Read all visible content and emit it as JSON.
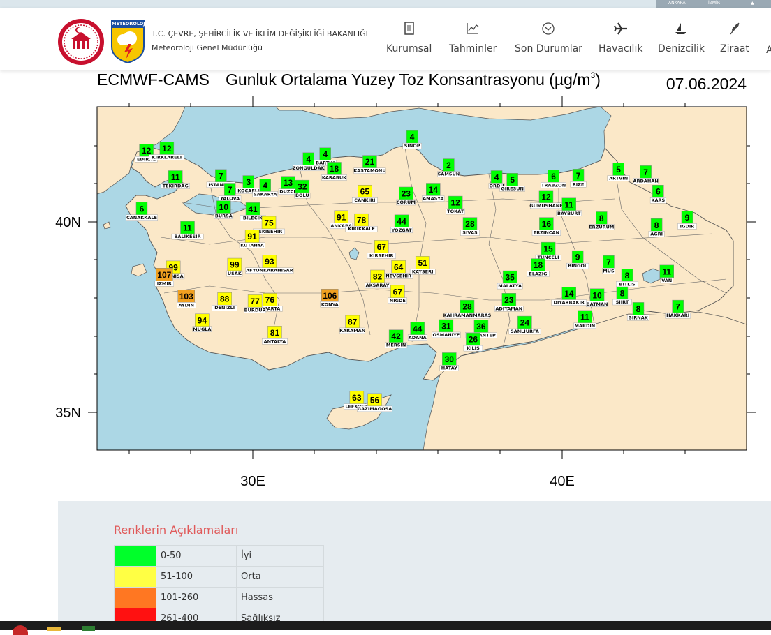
{
  "top_strip": {
    "buttons": [
      "ANKARA",
      "İZMİR"
    ]
  },
  "header": {
    "org_line1": "T.C. ÇEVRE, ŞEHİRCİLİK VE İKLİM DEĞİŞİKLİĞİ BAKANLIĞI",
    "org_line2": "Meteoroloji Genel Müdürlüğü",
    "logo_text": "METEOROLOJİ",
    "nav": [
      {
        "label": "Kurumsal",
        "icon": "document-icon"
      },
      {
        "label": "Tahminler",
        "icon": "chart-icon"
      },
      {
        "label": "Son Durumlar",
        "icon": "chevron-circle-icon"
      },
      {
        "label": "Havacılık",
        "icon": "airplane-icon"
      },
      {
        "label": "Denizcilik",
        "icon": "boat-icon"
      },
      {
        "label": "Ziraat",
        "icon": "wheat-icon"
      },
      {
        "label": "A",
        "icon": ""
      }
    ]
  },
  "map": {
    "title_left": "ECMWF-CAMS",
    "title_main": "Gunluk Ortalama Yuzey Toz Konsantrasyonu (µg/m",
    "title_sup": "3",
    "title_close": ")",
    "date": "07.06.2024",
    "lat_labels": [
      "40N",
      "35N"
    ],
    "lon_labels": [
      "30E",
      "40E"
    ],
    "colors": {
      "sea": "#acd7e5",
      "land": "#fbe8c8",
      "good": "#00ff00",
      "moderate": "#ffff00",
      "sensitive": "#f0a020",
      "border": "#555555"
    },
    "stations": [
      {
        "name": "EDIRNE",
        "value": "12",
        "lon": 26.56,
        "lat": 41.68
      },
      {
        "name": "KIRKLARELI",
        "value": "12",
        "lon": 27.22,
        "lat": 41.73
      },
      {
        "name": "TEKIRDAG",
        "value": "11",
        "lon": 27.5,
        "lat": 40.98
      },
      {
        "name": "ISTANBUL",
        "value": "7",
        "lon": 28.97,
        "lat": 41.01
      },
      {
        "name": "YALOVA",
        "value": "7",
        "lon": 29.26,
        "lat": 40.65
      },
      {
        "name": "KOCAELI",
        "value": "3",
        "lon": 29.86,
        "lat": 40.85
      },
      {
        "name": "SAKARYA",
        "value": "4",
        "lon": 30.4,
        "lat": 40.76
      },
      {
        "name": "DUZCE",
        "value": "13",
        "lon": 31.14,
        "lat": 40.83
      },
      {
        "name": "BOLU",
        "value": "32",
        "lon": 31.6,
        "lat": 40.73
      },
      {
        "name": "ZONGULDAK",
        "value": "4",
        "lon": 31.8,
        "lat": 41.45
      },
      {
        "name": "BARTIN",
        "value": "4",
        "lon": 32.34,
        "lat": 41.58
      },
      {
        "name": "KARABUK",
        "value": "18",
        "lon": 32.63,
        "lat": 41.2
      },
      {
        "name": "KASTAMONU",
        "value": "21",
        "lon": 33.78,
        "lat": 41.38
      },
      {
        "name": "SINOP",
        "value": "4",
        "lon": 35.15,
        "lat": 42.03
      },
      {
        "name": "SAMSUN",
        "value": "2",
        "lon": 36.33,
        "lat": 41.29
      },
      {
        "name": "CANAKKALE",
        "value": "6",
        "lon": 26.41,
        "lat": 40.15
      },
      {
        "name": "BURSA",
        "value": "10",
        "lon": 29.06,
        "lat": 40.19
      },
      {
        "name": "BILECIK",
        "value": "41",
        "lon": 30.0,
        "lat": 40.14
      },
      {
        "name": "ESKISEHIR",
        "value": "75",
        "lon": 30.52,
        "lat": 39.78
      },
      {
        "name": "BALIKESIR",
        "value": "11",
        "lon": 27.89,
        "lat": 39.65
      },
      {
        "name": "KUTAHYA",
        "value": "91",
        "lon": 29.98,
        "lat": 39.42
      },
      {
        "name": "ANKARA",
        "value": "91",
        "lon": 32.86,
        "lat": 39.93
      },
      {
        "name": "KIRIKKALE",
        "value": "78",
        "lon": 33.51,
        "lat": 39.85
      },
      {
        "name": "CANKIRI",
        "value": "65",
        "lon": 33.62,
        "lat": 40.6
      },
      {
        "name": "CORUM",
        "value": "23",
        "lon": 34.95,
        "lat": 40.55
      },
      {
        "name": "AMASYA",
        "value": "14",
        "lon": 35.83,
        "lat": 40.65
      },
      {
        "name": "TOKAT",
        "value": "12",
        "lon": 36.55,
        "lat": 40.31
      },
      {
        "name": "YOZGAT",
        "value": "44",
        "lon": 34.81,
        "lat": 39.82
      },
      {
        "name": "SIVAS",
        "value": "28",
        "lon": 37.02,
        "lat": 39.75
      },
      {
        "name": "ORDU",
        "value": "4",
        "lon": 37.88,
        "lat": 40.98
      },
      {
        "name": "GIRESUN",
        "value": "5",
        "lon": 38.39,
        "lat": 40.91
      },
      {
        "name": "TRABZON",
        "value": "6",
        "lon": 39.72,
        "lat": 41.0
      },
      {
        "name": "RIZE",
        "value": "7",
        "lon": 40.52,
        "lat": 41.02
      },
      {
        "name": "ARTVIN",
        "value": "5",
        "lon": 41.82,
        "lat": 41.18
      },
      {
        "name": "ARDAHAN",
        "value": "7",
        "lon": 42.7,
        "lat": 41.11
      },
      {
        "name": "KARS",
        "value": "6",
        "lon": 43.1,
        "lat": 40.6
      },
      {
        "name": "GUMUSHANE",
        "value": "12",
        "lon": 39.48,
        "lat": 40.46
      },
      {
        "name": "BAYBURT",
        "value": "11",
        "lon": 40.22,
        "lat": 40.26
      },
      {
        "name": "ERZURUM",
        "value": "8",
        "lon": 41.27,
        "lat": 39.9
      },
      {
        "name": "AGRI",
        "value": "8",
        "lon": 43.05,
        "lat": 39.72
      },
      {
        "name": "IGDIR",
        "value": "9",
        "lon": 44.04,
        "lat": 39.92
      },
      {
        "name": "ERZINCAN",
        "value": "16",
        "lon": 39.49,
        "lat": 39.75
      },
      {
        "name": "TUNCELI",
        "value": "15",
        "lon": 39.55,
        "lat": 39.1
      },
      {
        "name": "BINGOL",
        "value": "9",
        "lon": 40.5,
        "lat": 38.88
      },
      {
        "name": "MUS",
        "value": "7",
        "lon": 41.5,
        "lat": 38.75
      },
      {
        "name": "BITLIS",
        "value": "8",
        "lon": 42.1,
        "lat": 38.4
      },
      {
        "name": "VAN",
        "value": "11",
        "lon": 43.38,
        "lat": 38.5
      },
      {
        "name": "SIIRT",
        "value": "8",
        "lon": 41.94,
        "lat": 37.93
      },
      {
        "name": "BATMAN",
        "value": "10",
        "lon": 41.13,
        "lat": 37.88
      },
      {
        "name": "DIYARBAKIR",
        "value": "14",
        "lon": 40.22,
        "lat": 37.92
      },
      {
        "name": "SIRNAK",
        "value": "8",
        "lon": 42.46,
        "lat": 37.52
      },
      {
        "name": "HAKKARI",
        "value": "7",
        "lon": 43.74,
        "lat": 37.58
      },
      {
        "name": "MARDIN",
        "value": "11",
        "lon": 40.73,
        "lat": 37.31
      },
      {
        "name": "ELAZIG",
        "value": "18",
        "lon": 39.22,
        "lat": 38.67
      },
      {
        "name": "MALATYA",
        "value": "35",
        "lon": 38.31,
        "lat": 38.35
      },
      {
        "name": "ADIYAMAN",
        "value": "23",
        "lon": 38.28,
        "lat": 37.76
      },
      {
        "name": "SANLIURFA",
        "value": "24",
        "lon": 38.79,
        "lat": 37.16
      },
      {
        "name": "KAHRAMANMARAS",
        "value": "28",
        "lon": 36.93,
        "lat": 37.58
      },
      {
        "name": "GAZIANTEP",
        "value": "36",
        "lon": 37.38,
        "lat": 37.06
      },
      {
        "name": "KILIS",
        "value": "26",
        "lon": 37.12,
        "lat": 36.72
      },
      {
        "name": "OSMANIYE",
        "value": "31",
        "lon": 36.25,
        "lat": 37.07
      },
      {
        "name": "ADANA",
        "value": "44",
        "lon": 35.32,
        "lat": 37.0
      },
      {
        "name": "MERSIN",
        "value": "42",
        "lon": 34.63,
        "lat": 36.8
      },
      {
        "name": "HATAY",
        "value": "30",
        "lon": 36.35,
        "lat": 36.2
      },
      {
        "name": "KIRSEHIR",
        "value": "67",
        "lon": 34.16,
        "lat": 39.15
      },
      {
        "name": "NEVSEHIR",
        "value": "64",
        "lon": 34.71,
        "lat": 38.62
      },
      {
        "name": "KAYSERI",
        "value": "51",
        "lon": 35.49,
        "lat": 38.73
      },
      {
        "name": "AKSARAY",
        "value": "82",
        "lon": 34.03,
        "lat": 38.37
      },
      {
        "name": "NIGDE",
        "value": "67",
        "lon": 34.68,
        "lat": 37.97
      },
      {
        "name": "KONYA",
        "value": "106",
        "lon": 32.49,
        "lat": 37.87
      },
      {
        "name": "KARAMAN",
        "value": "87",
        "lon": 33.22,
        "lat": 37.18
      },
      {
        "name": "MANISA",
        "value": "99",
        "lon": 27.43,
        "lat": 38.61
      },
      {
        "name": "IZMIR",
        "value": "107",
        "lon": 27.14,
        "lat": 38.42
      },
      {
        "name": "USAK",
        "value": "99",
        "lon": 29.41,
        "lat": 38.68
      },
      {
        "name": "AFYONKARAHISAR",
        "value": "93",
        "lon": 30.54,
        "lat": 38.76
      },
      {
        "name": "AYDIN",
        "value": "103",
        "lon": 27.85,
        "lat": 37.85
      },
      {
        "name": "DENIZLI",
        "value": "88",
        "lon": 29.09,
        "lat": 37.78
      },
      {
        "name": "ISPARTA",
        "value": "76",
        "lon": 30.55,
        "lat": 37.76
      },
      {
        "name": "BURDUR",
        "value": "77",
        "lon": 30.07,
        "lat": 37.72
      },
      {
        "name": "MUGLA",
        "value": "94",
        "lon": 28.36,
        "lat": 37.22
      },
      {
        "name": "ANTALYA",
        "value": "81",
        "lon": 30.71,
        "lat": 36.9
      },
      {
        "name": "LEFKOSA",
        "value": "63",
        "lon": 33.36,
        "lat": 35.19
      },
      {
        "name": "GAZIMAGOSA",
        "value": "56",
        "lon": 33.94,
        "lat": 35.13
      }
    ]
  },
  "legend": {
    "title": "Renklerin Açıklamaları",
    "rows": [
      {
        "range": "0-50",
        "desc": "İyi",
        "color": "#00ff2a"
      },
      {
        "range": "51-100",
        "desc": "Orta",
        "color": "#ffff44"
      },
      {
        "range": "101-260",
        "desc": "Hassas",
        "color": "#ff7722"
      },
      {
        "range": "261-400",
        "desc": "Sağlıksız",
        "color": "#ff1111"
      }
    ]
  }
}
